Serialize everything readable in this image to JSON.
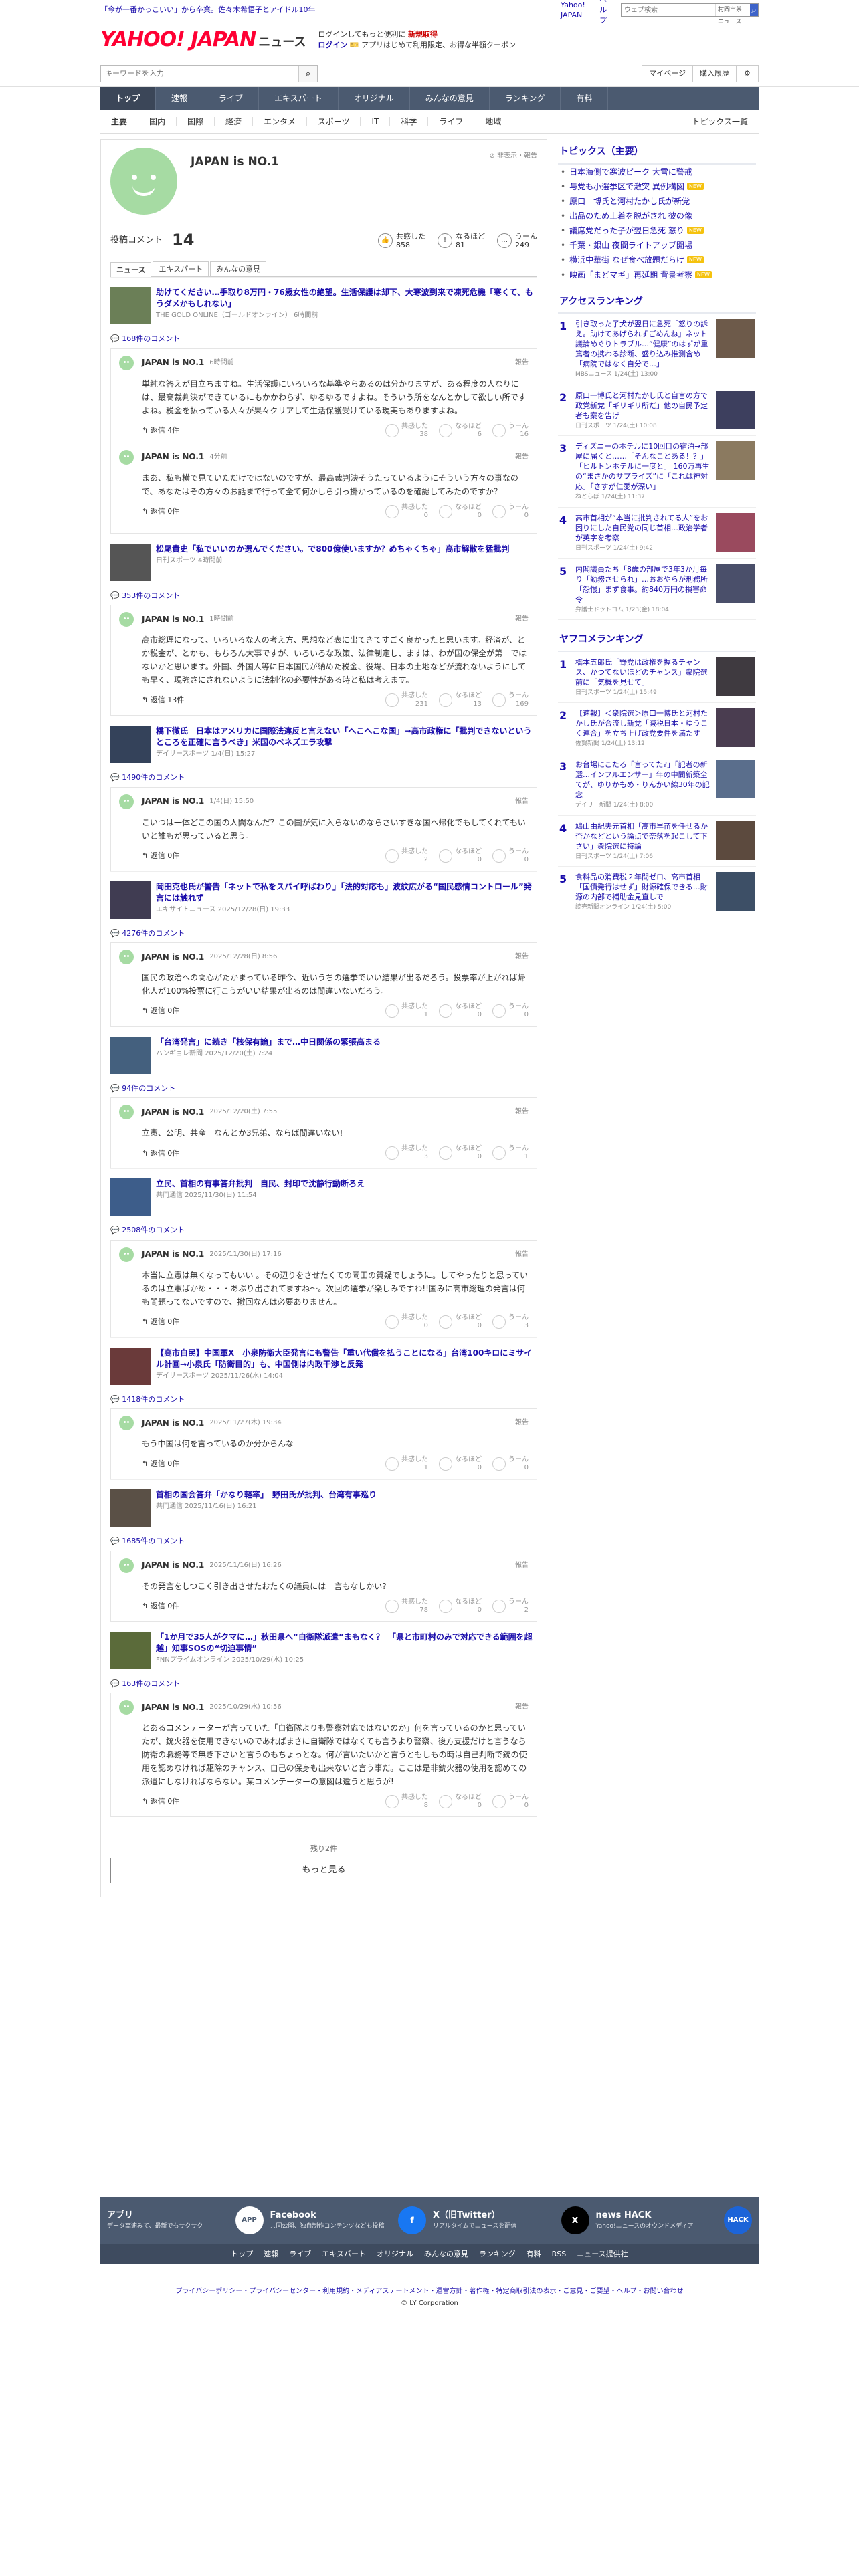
{
  "top": {
    "promo": "「今が一番かっこいい」から卒業。佐々木希悟子とアイドル10年",
    "links": [
      "Yahoo! JAPAN",
      "ヘルプ"
    ],
    "search_placeholder": "ウェブ検索",
    "search_btn": "検索",
    "sub": "村岡市茶 ニュース"
  },
  "header": {
    "logo": "YAHOO! JAPAN",
    "section": "ニュース",
    "promo1": "ログインしてもっと便利に",
    "promo1b": "新規取得",
    "promo2": "ログイン",
    "promo3": "アプリはじめて利用限定、お得な半額クーポン"
  },
  "searchbar": {
    "placeholder": "キーワードを入力",
    "links": [
      "マイページ",
      "購入履歴"
    ]
  },
  "nav": [
    "トップ",
    "速報",
    "ライブ",
    "エキスパート",
    "オリジナル",
    "みんなの意見",
    "ランキング",
    "有料"
  ],
  "subnav": [
    "主要",
    "国内",
    "国際",
    "経済",
    "エンタメ",
    "スポーツ",
    "IT",
    "科学",
    "ライフ",
    "地域"
  ],
  "topics_all": "トピックス一覧",
  "profile": {
    "name": "JAPAN is NO.1",
    "hide": "非表示・報告",
    "label": "投稿コメント",
    "count": "14",
    "s1": "共感した",
    "s1v": "858",
    "s2": "なるほど",
    "s2v": "81",
    "s3": "うーん",
    "s3v": "249"
  },
  "tabs": [
    "ニュース",
    "エキスパート",
    "みんなの意見"
  ],
  "vote_labels": [
    "共感した",
    "なるほど",
    "うーん"
  ],
  "report": "報告",
  "articles": [
    {
      "title": "助けてください…手取り8万円・76歳女性の絶望。生活保護は却下、大寒波到来で凍死危機「寒くて、もうダメかもしれない」",
      "src": "THE GOLD ONLINE（ゴールドオンライン） 6時間前",
      "count": "168件のコメント",
      "thumb": "#6b7f57",
      "comments": [
        {
          "name": "JAPAN is NO.1",
          "date": "6時間前",
          "body": "単純な答えが目立ちますね。生活保護にいろいろな基準やらあるのは分かりますが、ある程度の人なりには、最高裁判決ができているにもかかわらず、ゆるゆるですよね。そういう所をなんとかして欲しい所ですよね。税金を払っている人々が果々クリアして生活保護受けている現実もありますよね。",
          "reply": "返信 4件",
          "v": [
            "38",
            "6",
            "16"
          ]
        },
        {
          "name": "JAPAN is NO.1",
          "date": "4分前",
          "body": "まあ、私も横で見ていただけではないのですが、最高裁判決そうたっているようにそういう方々の事なので、あなたはその方々のお話まで行って全て何かしら引っ掛かっているのを確認してみたのですか？",
          "reply": "返信 0件",
          "v": [
            "0",
            "0",
            "0"
          ],
          "sub": true
        }
      ]
    },
    {
      "title": "松尾貴史「私でいいのか選んでください。で800億使いますか？めちゃくちゃ」高市解散を猛批判",
      "src": "日刊スポーツ 4時間前",
      "count": "353件のコメント",
      "thumb": "#555",
      "comments": [
        {
          "name": "JAPAN is NO.1",
          "date": "1時間前",
          "body": "高市総理になって、いろいろな人の考え方、思想など表に出てきてすごく良かったと思います。経済が、とか税金が、とかも、もちろん大事ですが、いろいろな政策、法律制定し、ますは、わが国の保全が第一ではないかと思います。外国、外国人等に日本国民が納めた税金、役場、日本の土地などが流れないようにしても早く、現強さにされないように法制化の必要性がある時と私は考えます。",
          "reply": "返信 13件",
          "v": [
            "231",
            "13",
            "169"
          ]
        }
      ]
    },
    {
      "title": "橋下徹氏　日本はアメリカに国際法違反と言えない「へこへこな国」→高市政権に「批判できないというところを正確に言うべき」米国のベネズエラ攻撃",
      "src": "デイリースポーツ 1/4(日) 15:27",
      "count": "1490件のコメント",
      "thumb": "#34425a",
      "comments": [
        {
          "name": "JAPAN is NO.1",
          "date": "1/4(日) 15:50",
          "body": "こいつは一体どこの国の人間なんだ？この国が気に入らないのならさいすきな国へ帰化でもしてくれてもいいと誰もが思っていると思う。",
          "reply": "返信 0件",
          "v": [
            "2",
            "0",
            "0"
          ]
        }
      ]
    },
    {
      "title": "岡田克也氏が警告「ネットで私をスパイ呼ばわり」「法的対応も」波紋広がる“国民感情コントロール”発言には触れず",
      "src": "エキサイトニュース 2025/12/28(日) 19:33",
      "count": "4276件のコメント",
      "thumb": "#403c52",
      "comments": [
        {
          "name": "JAPAN is NO.1",
          "date": "2025/12/28(日) 8:56",
          "body": "国民の政治への関心がたかまっている昨今、近いうちの選挙でいい結果が出るだろう。投票率が上がれば帰化人が100%投票に行こうがいい結果が出るのは間違いないだろう。",
          "reply": "返信 0件",
          "v": [
            "1",
            "0",
            "0"
          ]
        }
      ]
    },
    {
      "title": "「台湾発言」に続き「核保有論」まで…中日関係の緊張高まる",
      "src": "ハンギョレ新聞 2025/12/20(土) 7:24",
      "count": "94件のコメント",
      "thumb": "#44607e",
      "comments": [
        {
          "name": "JAPAN is NO.1",
          "date": "2025/12/20(土) 7:55",
          "body": "立憲、公明、共産　なんとか3兄弟、ならば間違いない!",
          "reply": "返信 0件",
          "v": [
            "3",
            "0",
            "1"
          ]
        }
      ]
    },
    {
      "title": "立民、首相の有事答弁批判　自民、封印で沈静行動断ろえ",
      "src": "共同通信 2025/11/30(日) 11:54",
      "count": "2508件のコメント",
      "thumb": "#3d5d8a",
      "comments": [
        {
          "name": "JAPAN is NO.1",
          "date": "2025/11/30(日) 17:16",
          "body": "本当に立憲は無くなってもいい\n。その辺りをさせたくての岡田の質疑でしょうに。してやったりと思っているのは立憲ばかめ・・・あぶり出されてますね〜。次回の選挙が楽しみですわ!!国みに高市総理の発言は何も問題ってないですので、撤回なんは必要ありません。",
          "reply": "返信 0件",
          "v": [
            "0",
            "0",
            "3"
          ]
        }
      ]
    },
    {
      "title": "【高市自民】中国軍X　小泉防衛大臣発言にも警告「重い代償を払うことになる」台湾100キロにミサイル計画→小泉氏「防衛目的」も、中国側は内政干渉と反発",
      "src": "デイリースポーツ 2025/11/26(水) 14:04",
      "count": "1418件のコメント",
      "thumb": "#6a3a3a",
      "comments": [
        {
          "name": "JAPAN is NO.1",
          "date": "2025/11/27(木) 19:34",
          "body": "もう中国は何を言っているのか分からんな",
          "reply": "返信 0件",
          "v": [
            "1",
            "0",
            "0"
          ]
        }
      ]
    },
    {
      "title": "首相の国会答弁「かなり軽率」　野田氏が批判、台湾有事巡り",
      "src": "共同通信 2025/11/16(日) 16:21",
      "count": "1685件のコメント",
      "thumb": "#5a5046",
      "comments": [
        {
          "name": "JAPAN is NO.1",
          "date": "2025/11/16(日) 16:26",
          "body": "その発言をしつこく引き出させたおたくの議員には一言もなしかい?",
          "reply": "返信 0件",
          "v": [
            "78",
            "0",
            "2"
          ]
        }
      ]
    },
    {
      "title": "「1か月で35人がクマに…」秋田県へ“自衛隊派遣”まもなく？　「県と市町村のみで対応できる範囲を超越」知事SOSの“切迫事情”",
      "src": "FNNプライムオンライン 2025/10/29(水) 10:25",
      "count": "163件のコメント",
      "thumb": "#5b6b3a",
      "comments": [
        {
          "name": "JAPAN is NO.1",
          "date": "2025/10/29(水) 10:56",
          "body": "とあるコメンテーターが言っていた「自衛隊よりも警察対応ではないのか」何を言っているのかと思っていたが、銃火器を使用できないのであればまさに自衛隊ではなくても言うより警察、後方支援だけと言うなら防衛の職務等で無き下さいと言うのもちょっとな。何が言いたいかと言うともしもの時は自己判断で銃の使用を認めなければ駆除のチャンス、自己の保身も出来ないと言う事だ。ここは是非銃火器の使用を認めての派遣にしなければならない。某コメンテーターの意図は違うと思うが!",
          "reply": "返信 0件",
          "v": [
            "8",
            "0",
            "0"
          ]
        }
      ]
    }
  ],
  "more": {
    "remaining": "残り2件",
    "button": "もっと見る"
  },
  "topics": {
    "title": "トピックス（主要）",
    "items": [
      "日本海側で寒波ピーク 大雪に警戒",
      "与党も小選挙区で激突 異例構図",
      "原口一博氏と河村たかし氏が新党",
      "出品のため上着を脱がされ 彼の像",
      "議席党だった子が翌日急死 怒り",
      "千葉・銀山 夜間ライトアップ開場",
      "横浜中華街 なぜ食べ放題だらけ",
      "映画「まどマギ」再延期 背景考察"
    ],
    "new": [
      false,
      true,
      false,
      false,
      true,
      false,
      true,
      true
    ]
  },
  "access": {
    "title": "アクセスランキング",
    "items": [
      {
        "t": "引き取った子犬が翌日に急死「怒りの訴え。助けてあげられずごめんね」ネット議論めぐりトラブル…“健康”のはずが重篤者の携わる診断、盛り込み推測含め「病院ではなく自分で…」",
        "s": "MBSニュース 1/24(土) 13:00",
        "c": "#6d5a4a"
      },
      {
        "t": "原口一博氏と河村たかし氏と自言の方で　政党新党「ギリギリ所だ」他の自民予定者も案を告げ",
        "s": "日刊スポーツ 1/24(土) 10:08",
        "c": "#3d3f5e"
      },
      {
        "t": "ディズニーのホテルに10回目の宿泊→部屋に届くと……「そんなことある！？」「ヒルトンホテルに一度と」 160万再生の“まさかのサプライズ”に「これは神対応」「さすが仁愛が深い」",
        "s": "ねとらぼ 1/24(土) 11:37",
        "c": "#8b7a60"
      },
      {
        "t": "高市首相が“本当に批判されてる人”をお困りにした自民党の同じ首相…政治学者が英字を考察",
        "s": "日刊スポーツ 1/24(土) 9:42",
        "c": "#9a4a5e"
      },
      {
        "t": "内閣議員たち「8歳の部屋で3年3か月毎り「勤務させられ」…おおやらが刑務所「怨恨」まず食事。約840万円の損害命令",
        "s": "弁護士ドットコム 1/23(金) 18:04",
        "c": "#4a4f6a"
      }
    ]
  },
  "yafoo": {
    "title": "ヤフコメランキング",
    "items": [
      {
        "t": "橋本五郎氏「野党は政権を握るチャンス、かつてないほどのチャンス」衆院選前に「気概を見せて」",
        "s": "日刊スポーツ 1/24(土) 15:49",
        "c": "#3f3a40"
      },
      {
        "t": "【速報】＜衆院選＞原口一博氏と河村たかし氏が合流し新党「減税日本・ゆうこく連合」を立ち上げ政党要件を満たす",
        "s": "佐賀新聞 1/24(土) 13:12",
        "c": "#4a3d50"
      },
      {
        "t": "お台場にこたる「言ってた?」「記者の新選…インフルエンサー」年の中間新築全てが、ゆりかもめ・りんかい線30年の記念",
        "s": "デイリー新聞 1/24(土) 8:00",
        "c": "#5a6e8c"
      },
      {
        "t": "鳩山由紀夫元首相「高市早苗を任せるか否かなどという論点で奈落を起こして下さい」衆院選に持論",
        "s": "日刊スポーツ 1/24(土) 7:06",
        "c": "#5c4a3e"
      },
      {
        "t": "食料品の消費税２年間ゼロ、高市首相「国債発行はせず」財源確保できる…財源の内部で補助金見直しで",
        "s": "読売新聞オンライン 1/24(土) 5:00",
        "c": "#3d4f66"
      }
    ]
  },
  "footer": {
    "cols": [
      {
        "t": "アプリ",
        "d": "データ高速みて、最新でもサクサク",
        "i": "APP"
      },
      {
        "t": "Facebook",
        "d": "共同公開、独自制作コンテンツなども投稿",
        "i": "f"
      },
      {
        "t": "X（旧Twitter）",
        "d": "リアルタイムでニュースを配信",
        "i": "X"
      },
      {
        "t": "news HACK",
        "d": "Yahoo!ニュースのオウンドメディア",
        "i": "HACK"
      }
    ],
    "links": [
      "トップ",
      "速報",
      "ライブ",
      "エキスパート",
      "オリジナル",
      "みんなの意見",
      "ランキング",
      "有料",
      "RSS",
      "ニュース提供社"
    ],
    "bottom": "プライバシーポリシー・プライバシーセンター・利用規約・メディアステートメント・運営方針・著作権・特定商取引法の表示・ご意見・ご要望・ヘルプ・お問い合わせ",
    "copy": "© LY Corporation"
  }
}
